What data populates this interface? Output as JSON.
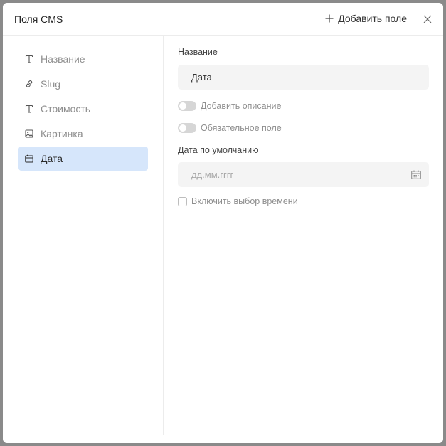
{
  "modal": {
    "title": "Поля CMS",
    "add_field_label": "Добавить поле"
  },
  "sidebar": {
    "items": [
      {
        "label": "Название",
        "icon": "text-type-icon",
        "active": false
      },
      {
        "label": "Slug",
        "icon": "link-icon",
        "active": false
      },
      {
        "label": "Стоимость",
        "icon": "text-type-icon",
        "active": false
      },
      {
        "label": "Картинка",
        "icon": "image-icon",
        "active": false
      },
      {
        "label": "Дата",
        "icon": "calendar-icon",
        "active": true
      }
    ]
  },
  "form": {
    "name_label": "Название",
    "name_value": "Дата",
    "add_description_label": "Добавить описание",
    "add_description_on": false,
    "required_label": "Обязательное поле",
    "required_on": false,
    "default_date_label": "Дата по умолчанию",
    "default_date_placeholder": "дд.мм.гггг",
    "enable_time_label": "Включить выбор времени",
    "enable_time_checked": false
  },
  "colors": {
    "active_item_bg": "#d6e6fb",
    "input_bg": "#f4f4f4",
    "muted_text": "#8e8e8e"
  }
}
